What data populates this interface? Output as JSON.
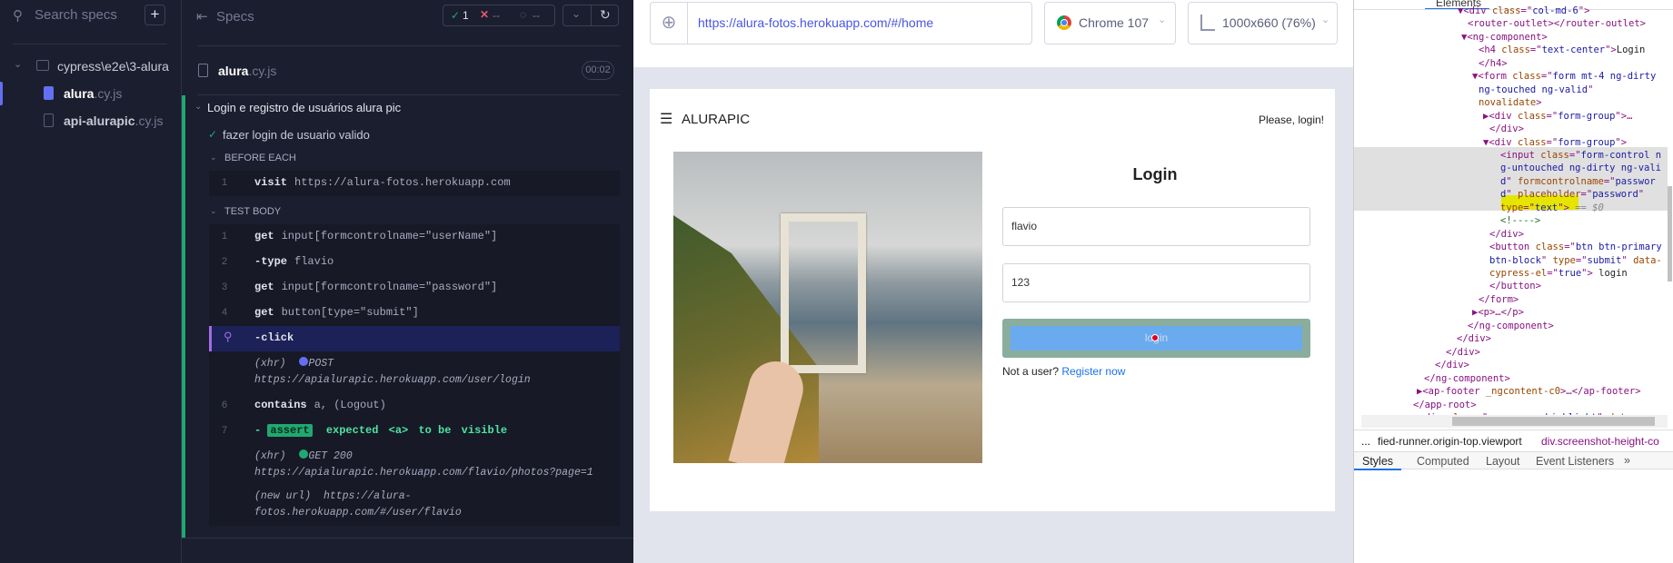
{
  "sidebar": {
    "search_placeholder": "Search specs",
    "add_label": "+",
    "folder": "cypress\\e2e\\3-alura",
    "files": [
      {
        "name": "alura",
        "ext": ".cy.js",
        "active": true
      },
      {
        "name": "api-alurapic",
        "ext": ".cy.js",
        "active": false
      }
    ]
  },
  "reporter": {
    "title": "Specs",
    "stats": {
      "passed": "1",
      "failed": "--",
      "pending": "--"
    },
    "file": {
      "name": "alura",
      "ext": ".cy.js",
      "duration": "00:02"
    },
    "suite": "Login e registro de usuários alura pic",
    "test": "fazer login de usuario valido",
    "before_each_label": "BEFORE EACH",
    "before_each": [
      {
        "num": "1",
        "cmd": "visit",
        "args": "https://alura-fotos.herokuapp.com"
      }
    ],
    "test_body_label": "TEST BODY",
    "commands": [
      {
        "num": "1",
        "cmd": "get",
        "args": "input[formcontrolname=\"userName\"]"
      },
      {
        "num": "2",
        "cmd": "-type",
        "args": "flavio"
      },
      {
        "num": "3",
        "cmd": "get",
        "args": "input[formcontrolname=\"password\"]"
      },
      {
        "num": "4",
        "cmd": "get",
        "args": "button[type=\"submit\"]"
      },
      {
        "num": "",
        "cmd": "-click",
        "args": "",
        "active": true
      },
      {
        "xhr": "(xhr)",
        "method": "POST",
        "url": "https://apialurapic.herokuapp.com/user/login",
        "dot": "#6470f3"
      },
      {
        "num": "6",
        "cmd": "contains",
        "args": "a, (Logout)"
      },
      {
        "num": "7",
        "assert": "assert",
        "parts": [
          "expected",
          "<a>",
          "to be",
          "visible"
        ]
      },
      {
        "xhr": "(xhr)",
        "method": "GET 200",
        "url": "https://apialurapic.herokuapp.com/flavio/photos?page=1",
        "dot": "#1fa971"
      },
      {
        "newurl": "(new url)",
        "url1": "https://alura-",
        "url2": "fotos.herokuapp.com/#/user/flavio"
      }
    ]
  },
  "aut": {
    "url": "https://alura-fotos.herokuapp.com/#/home",
    "browser": "Chrome 107",
    "viewport": "1000x660 (76%)",
    "app": {
      "brand": "ALURAPIC",
      "status": "Please, login!",
      "login_title": "Login",
      "username": "flavio",
      "password": "123",
      "button": "login",
      "not_user": "Not a user?",
      "register": "Register now"
    }
  },
  "devtools": {
    "tab": "Elements",
    "lines": [
      [
        [
          "t",
          "▼<div "
        ],
        [
          "a",
          "class"
        ],
        [
          "t",
          "=\""
        ],
        [
          "v",
          "col-md-6"
        ],
        [
          "t",
          "\">"
        ]
      ],
      [
        [
          "t",
          "<router-outlet></router-outlet>"
        ]
      ],
      [
        [
          "t",
          "▼<ng-component>"
        ]
      ],
      [
        [
          "t",
          "<h4 "
        ],
        [
          "a",
          "class"
        ],
        [
          "t",
          "=\""
        ],
        [
          "v",
          "text-center"
        ],
        [
          "t",
          "\">"
        ],
        [
          "x",
          "Login"
        ]
      ],
      [
        [
          "t",
          "</h4>"
        ]
      ],
      [
        [
          "t",
          "▼<form "
        ],
        [
          "a",
          "class"
        ],
        [
          "t",
          "=\""
        ],
        [
          "v",
          "form mt-4 ng-dirty"
        ]
      ],
      [
        [
          "v",
          "ng-touched ng-valid"
        ],
        [
          "t",
          "\""
        ]
      ],
      [
        [
          "a",
          "novalidate"
        ],
        [
          "t",
          ">"
        ]
      ],
      [
        [
          "t",
          "▶<div "
        ],
        [
          "a",
          "class"
        ],
        [
          "t",
          "=\""
        ],
        [
          "v",
          "form-group"
        ],
        [
          "t",
          "\">…"
        ]
      ],
      [
        [
          "t",
          "</div>"
        ]
      ],
      [
        [
          "t",
          "▼<div "
        ],
        [
          "a",
          "class"
        ],
        [
          "t",
          "=\""
        ],
        [
          "v",
          "form-group"
        ],
        [
          "t",
          "\">"
        ]
      ],
      [
        [
          "t",
          "<input "
        ],
        [
          "a",
          "class"
        ],
        [
          "t",
          "=\""
        ],
        [
          "v",
          "form-control n"
        ]
      ],
      [
        [
          "v",
          "g-untouched ng-dirty ng-vali"
        ]
      ],
      [
        [
          "v",
          "d"
        ],
        [
          "t",
          "\" "
        ],
        [
          "a",
          "formcontrolname"
        ],
        [
          "t",
          "=\""
        ],
        [
          "v",
          "passwor"
        ]
      ],
      [
        [
          "v",
          "d"
        ],
        [
          "t",
          "\" "
        ],
        [
          "a",
          "placeholder"
        ],
        [
          "t",
          "=\""
        ],
        [
          "v",
          "password"
        ],
        [
          "t",
          "\""
        ]
      ],
      [
        [
          "a",
          "type"
        ],
        [
          "t",
          "=\""
        ],
        [
          "v",
          "text"
        ],
        [
          "t",
          "\">"
        ],
        [
          "s",
          " == $0"
        ]
      ],
      [
        [
          "c",
          "<!---->"
        ]
      ],
      [
        [
          "t",
          "</div>"
        ]
      ],
      [
        [
          "t",
          "<button "
        ],
        [
          "a",
          "class"
        ],
        [
          "t",
          "=\""
        ],
        [
          "v",
          "btn btn-primary"
        ]
      ],
      [
        [
          "v",
          "btn-block"
        ],
        [
          "t",
          "\" "
        ],
        [
          "a",
          "type"
        ],
        [
          "t",
          "=\""
        ],
        [
          "v",
          "submit"
        ],
        [
          "t",
          "\" "
        ],
        [
          "a",
          "data-"
        ]
      ],
      [
        [
          "a",
          "cypress-el"
        ],
        [
          "t",
          "=\""
        ],
        [
          "v",
          "true"
        ],
        [
          "t",
          "\">"
        ],
        [
          "x",
          " login"
        ]
      ],
      [
        [
          "t",
          "</button>"
        ]
      ],
      [
        [
          "t",
          "</form>"
        ]
      ],
      [
        [
          "t",
          "▶<p>…</p>"
        ]
      ],
      [
        [
          "t",
          "</ng-component>"
        ]
      ],
      [
        [
          "t",
          "</div>"
        ]
      ],
      [
        [
          "t",
          "</div>"
        ]
      ],
      [
        [
          "t",
          "</div>"
        ]
      ],
      [
        [
          "t",
          "</ng-component>"
        ]
      ],
      [
        [
          "t",
          "▶<ap-footer "
        ],
        [
          "a",
          "_ngcontent-c0"
        ],
        [
          "t",
          ">…</ap-footer>"
        ]
      ],
      [
        [
          "t",
          "</app-root>"
        ]
      ],
      [
        [
          "t",
          "▶<div "
        ],
        [
          "a",
          "class"
        ],
        [
          "t",
          "=\""
        ],
        [
          "v",
          "__cypress-highlight"
        ],
        [
          "t",
          "\" "
        ],
        [
          "a",
          "data-"
        ]
      ]
    ],
    "breadcrumb": [
      "...",
      "fied-runner.origin-top.viewport",
      "div.screenshot-height-co"
    ],
    "tabs": [
      "Styles",
      "Computed",
      "Layout",
      "Event Listeners",
      "»"
    ]
  },
  "colors": {
    "pass": "#1fa971",
    "fail": "#e45770",
    "accent": "#6470f3",
    "active_row": "#1c2157",
    "highlight": "#ffff00"
  }
}
